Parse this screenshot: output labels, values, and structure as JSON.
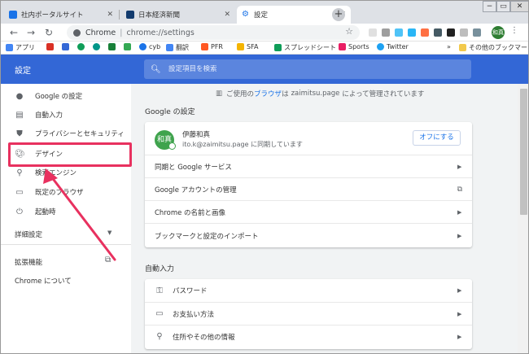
{
  "tabs": [
    {
      "label": "社内ポータルサイト",
      "icon": "portal-favicon",
      "color": "#1a73e8"
    },
    {
      "label": "日本経済新聞",
      "icon": "nikkei-favicon",
      "color": "#123b6e"
    },
    {
      "label": "設定",
      "icon": "settings-gear-favicon",
      "color": "#1a73e8"
    }
  ],
  "toolbar": {
    "chrome_label": "Chrome",
    "url": "chrome://settings",
    "profile_initials": "和真"
  },
  "bookmarks": [
    {
      "label": "アプリ",
      "icon": "apps-grid-icon",
      "color": "#4285f4"
    },
    {
      "label": "",
      "icon": "gmail-icon",
      "color": "#d93025"
    },
    {
      "label": "",
      "icon": "blue-square-icon",
      "color": "#3367d6"
    },
    {
      "label": "",
      "icon": "green-circle-icon",
      "color": "#0f9d58"
    },
    {
      "label": "",
      "icon": "teal-icon",
      "color": "#009688"
    },
    {
      "label": "",
      "icon": "green-square-icon",
      "color": "#188038"
    },
    {
      "label": "",
      "icon": "sheet-icon",
      "color": "#34a853"
    },
    {
      "label": "cyb",
      "icon": "cyb-icon",
      "color": "#1a73e8"
    },
    {
      "label": "翻訳",
      "icon": "translate-icon",
      "color": "#4285f4"
    },
    {
      "label": "PFR",
      "icon": "pfr-icon",
      "color": "#ff5722"
    },
    {
      "label": "SFA",
      "icon": "sfa-icon",
      "color": "#f4b400"
    },
    {
      "label": "スプレッドシート",
      "icon": "spreadsheet-icon",
      "color": "#0f9d58"
    },
    {
      "label": "Sports",
      "icon": "sports-icon",
      "color": "#e91e63"
    },
    {
      "label": "Twitter",
      "icon": "twitter-icon",
      "color": "#1da1f2"
    },
    {
      "label": "»",
      "icon": "",
      "color": ""
    },
    {
      "label": "その他のブックマーク",
      "icon": "folder-icon",
      "color": "#f2c94c"
    }
  ],
  "header": {
    "title": "設定",
    "search_placeholder": "設定項目を検索"
  },
  "sidebar": {
    "items": [
      {
        "label": "Google の設定",
        "icon": "person-icon"
      },
      {
        "label": "自動入力",
        "icon": "clipboard-icon"
      },
      {
        "label": "プライバシーとセキュリティ",
        "icon": "shield-icon"
      },
      {
        "label": "デザイン",
        "icon": "palette-icon"
      },
      {
        "label": "検索エンジン",
        "icon": "search-icon"
      },
      {
        "label": "既定のブラウザ",
        "icon": "browser-icon"
      },
      {
        "label": "起動時",
        "icon": "power-icon"
      }
    ],
    "advanced": "詳細設定",
    "extensions": "拡張機能",
    "about": "Chrome について"
  },
  "main": {
    "managed_prefix": "ご使用の",
    "managed_link": "ブラウザ",
    "managed_middle": "は",
    "managed_domain": "zaimitsu.page",
    "managed_suffix": "によって管理されています",
    "google_section_title": "Google の設定",
    "profile": {
      "avatar_text": "和真",
      "name": "伊藤和真",
      "sync_text": "ito.k@zaimitsu.page に同期しています",
      "sync_off_button": "オフにする"
    },
    "google_rows": [
      "同期と Google サービス",
      "Google アカウントの管理",
      "Chrome の名前と画像",
      "ブックマークと設定のインポート"
    ],
    "autofill_section_title": "自動入力",
    "autofill_rows": [
      {
        "label": "パスワード",
        "icon": "key-icon"
      },
      {
        "label": "お支払い方法",
        "icon": "credit-card-icon"
      },
      {
        "label": "住所やその他の情報",
        "icon": "location-pin-icon"
      }
    ]
  },
  "annotation": {
    "highlight_color": "#e8315f"
  }
}
